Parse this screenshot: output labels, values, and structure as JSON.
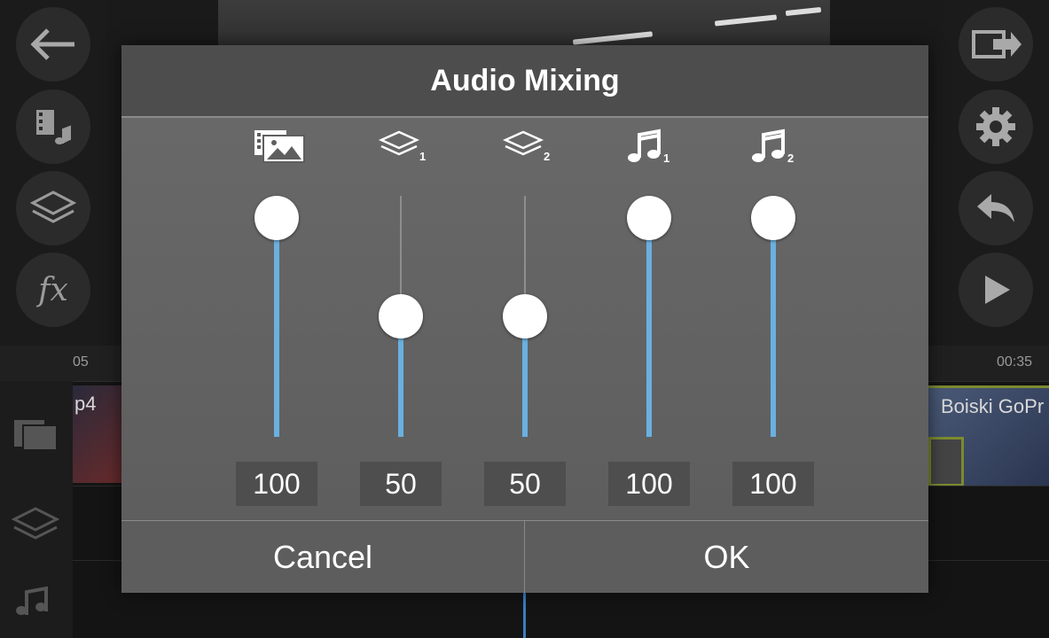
{
  "app": {
    "timeline": {
      "ruler_start_label": "05",
      "ruler_end_label": "00:35",
      "clip_left_label": "p4",
      "clip_right_label": "Boiski GoPr"
    }
  },
  "left_toolbar": [
    {
      "name": "back-arrow-icon"
    },
    {
      "name": "media-audio-icon"
    },
    {
      "name": "layers-icon"
    },
    {
      "name": "fx-icon",
      "text": "fx"
    }
  ],
  "right_toolbar": [
    {
      "name": "export-icon"
    },
    {
      "name": "gear-icon"
    },
    {
      "name": "undo-icon"
    },
    {
      "name": "play-icon"
    }
  ],
  "dialog": {
    "title": "Audio Mixing",
    "cancel_label": "Cancel",
    "ok_label": "OK",
    "accent_color": "#6ab0e0",
    "channels": [
      {
        "icon": "video-clip-icon",
        "subscript": "",
        "value": "100",
        "level": 1.0
      },
      {
        "icon": "layer-icon",
        "subscript": "1",
        "value": "50",
        "level": 0.5
      },
      {
        "icon": "layer-icon",
        "subscript": "2",
        "value": "50",
        "level": 0.5
      },
      {
        "icon": "music-note-icon",
        "subscript": "1",
        "value": "100",
        "level": 1.0
      },
      {
        "icon": "music-note-icon",
        "subscript": "2",
        "value": "100",
        "level": 1.0
      }
    ]
  }
}
